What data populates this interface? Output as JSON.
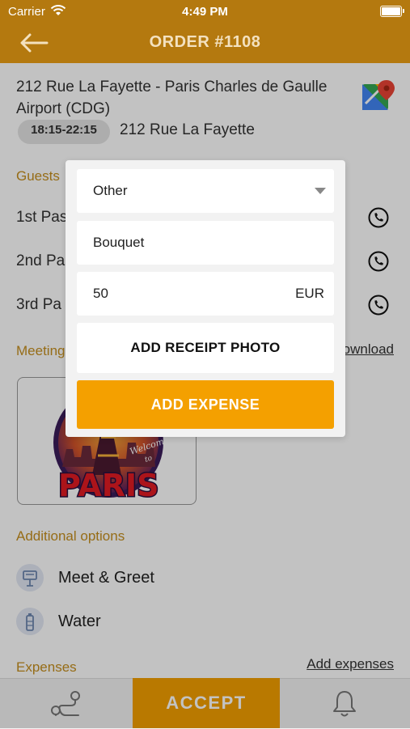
{
  "status_bar": {
    "carrier": "Carrier",
    "time": "4:49 PM"
  },
  "header": {
    "title": "ORDER #1108"
  },
  "trip": {
    "address": "212 Rue La Fayette - Paris Charles de Gaulle Airport (CDG)",
    "time_window": "18:15-22:15",
    "pickup_address": "212 Rue La Fayette"
  },
  "guests": {
    "title": "Guests",
    "items": [
      {
        "label": "1st Pas"
      },
      {
        "label": "2nd Pa"
      },
      {
        "label": "3rd Pa"
      }
    ]
  },
  "meeting": {
    "title": "Meeting",
    "download_label": "ownload"
  },
  "additional_options": {
    "title": "Additional options",
    "items": [
      {
        "label": "Meet & Greet",
        "icon": "sign-icon"
      },
      {
        "label": "Water",
        "icon": "water-bottle-icon"
      }
    ]
  },
  "expenses": {
    "title": "Expenses",
    "add_link": "Add expenses"
  },
  "tabbar": {
    "accept_label": "ACCEPT"
  },
  "modal": {
    "category_value": "Other",
    "description_value": "Bouquet",
    "amount_value": "50",
    "currency": "EUR",
    "receipt_button": "ADD RECEIPT PHOTO",
    "submit_button": "ADD EXPENSE"
  },
  "colors": {
    "header": "#b4790f",
    "accent": "#f4a000",
    "section_title": "#c58f1e"
  }
}
